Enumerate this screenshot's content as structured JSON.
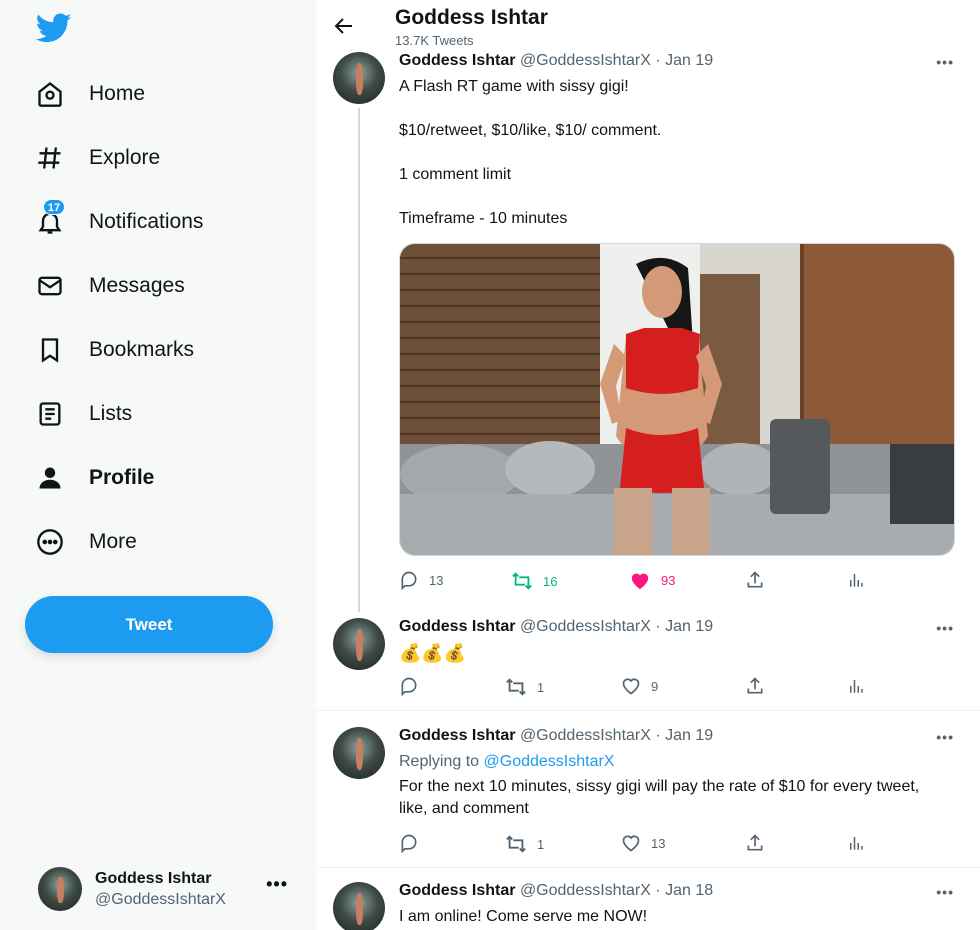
{
  "sidebar": {
    "logo": "twitter-bird-icon",
    "nav": [
      {
        "label": "Home",
        "icon": "home-icon"
      },
      {
        "label": "Explore",
        "icon": "hashtag-icon"
      },
      {
        "label": "Notifications",
        "icon": "bell-icon",
        "badge": "17"
      },
      {
        "label": "Messages",
        "icon": "envelope-icon"
      },
      {
        "label": "Bookmarks",
        "icon": "bookmark-icon"
      },
      {
        "label": "Lists",
        "icon": "list-icon"
      },
      {
        "label": "Profile",
        "icon": "person-icon",
        "active": true
      },
      {
        "label": "More",
        "icon": "more-circle-icon"
      }
    ],
    "tweet_button": "Tweet",
    "account": {
      "name": "Goddess Ishtar",
      "handle": "@GoddessIshtarX",
      "more": "•••"
    }
  },
  "header": {
    "title": "Goddess Ishtar",
    "subtitle": "13.7K Tweets"
  },
  "tweets": [
    {
      "name": "Goddess Ishtar",
      "meta": "@GoddessIshtarX · Jan 19",
      "paragraphs": [
        "A Flash RT game with sissy gigi!",
        "$10/retweet, $10/like, $10/ comment.",
        "1 comment limit",
        "Timeframe - 10 minutes"
      ],
      "replies": "13",
      "retweets": "16",
      "likes": "93"
    },
    {
      "name": "Goddess Ishtar",
      "meta": "@GoddessIshtarX · Jan 19",
      "emoji": "💰💰💰",
      "replies": "",
      "retweets": "1",
      "likes": "9"
    },
    {
      "name": "Goddess Ishtar",
      "meta": "@GoddessIshtarX · Jan 19",
      "replying_prefix": "Replying to ",
      "replying_to": "@GoddessIshtarX",
      "text": "For the next 10 minutes, sissy gigi will pay the rate of $10 for every tweet, like, and comment",
      "replies": "",
      "retweets": "1",
      "likes": "13"
    },
    {
      "name": "Goddess Ishtar",
      "meta": "@GoddessIshtarX · Jan 18",
      "text": "I am online! Come serve me NOW!"
    }
  ],
  "colors": {
    "accent": "#1d9bf0",
    "retweet": "#00ba7c",
    "like": "#f91880",
    "muted": "#536471"
  }
}
